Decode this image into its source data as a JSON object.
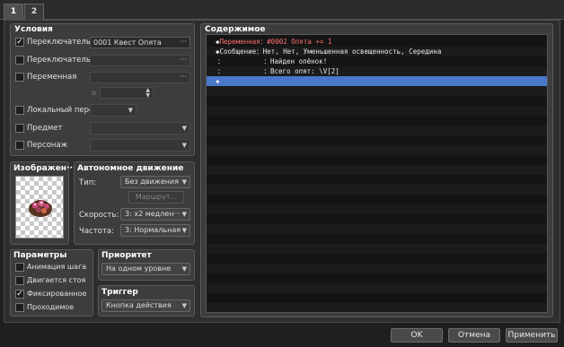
{
  "tabs": [
    "1",
    "2"
  ],
  "conditions": {
    "title": "Условия",
    "switch1": {
      "label": "Переключатель",
      "checked": true,
      "value": "0001 Квест Опята"
    },
    "switch2": {
      "label": "Переключатель",
      "checked": false,
      "value": ""
    },
    "variable": {
      "label": "Переменная",
      "checked": false,
      "value": ""
    },
    "local_switch": {
      "label": "Локальный перек"
    },
    "item": {
      "label": "Предмет"
    },
    "actor": {
      "label": "Персонаж"
    }
  },
  "image": {
    "title": "Изображен···"
  },
  "autonomous": {
    "title": "Автономное движение",
    "type_label": "Тип:",
    "type_value": "Без движения",
    "route_button": "Маршрут...",
    "speed_label": "Скорость:",
    "speed_value": "3: x2 медлен···",
    "freq_label": "Частота:",
    "freq_value": "3: Нормальная"
  },
  "options": {
    "title": "Параметры",
    "items": [
      {
        "label": "Анимация шага",
        "checked": false
      },
      {
        "label": "Двигается стоя",
        "checked": false
      },
      {
        "label": "Фиксированное",
        "checked": true
      },
      {
        "label": "Проходимое",
        "checked": false
      }
    ]
  },
  "priority": {
    "title": "Приоритет",
    "value": "На одном уровне"
  },
  "trigger": {
    "title": "Триггер",
    "value": "Кнопка действия"
  },
  "contents": {
    "title": "Содержимое",
    "lines": [
      {
        "prefix": "◆",
        "cmd": "Переменная",
        "sep": "：",
        "text": "#0002 Опята += 1",
        "color": "#ff7070"
      },
      {
        "prefix": "◆",
        "cmd": "Сообщение",
        "sep": "：",
        "text": "Нет, Нет, Уменьшенная освещенность, Середина",
        "color": "#e8e8e8"
      },
      {
        "prefix": "：",
        "cmd": "",
        "sep": "：",
        "text": "Найден опёнок!",
        "color": "#e8e8e8"
      },
      {
        "prefix": "：",
        "cmd": "",
        "sep": "：",
        "text": "Всего опят: \\V[2]",
        "color": "#e8e8e8"
      },
      {
        "prefix": "◆",
        "cmd": "",
        "sep": "",
        "text": "",
        "color": "#e8e8e8"
      }
    ]
  },
  "buttons": {
    "ok": "OK",
    "cancel": "Отмена",
    "apply": "Применить"
  },
  "colors": {
    "selection": "#4a78c8",
    "variable_cmd": "#ff7070",
    "bg": "#2e2e2e"
  }
}
